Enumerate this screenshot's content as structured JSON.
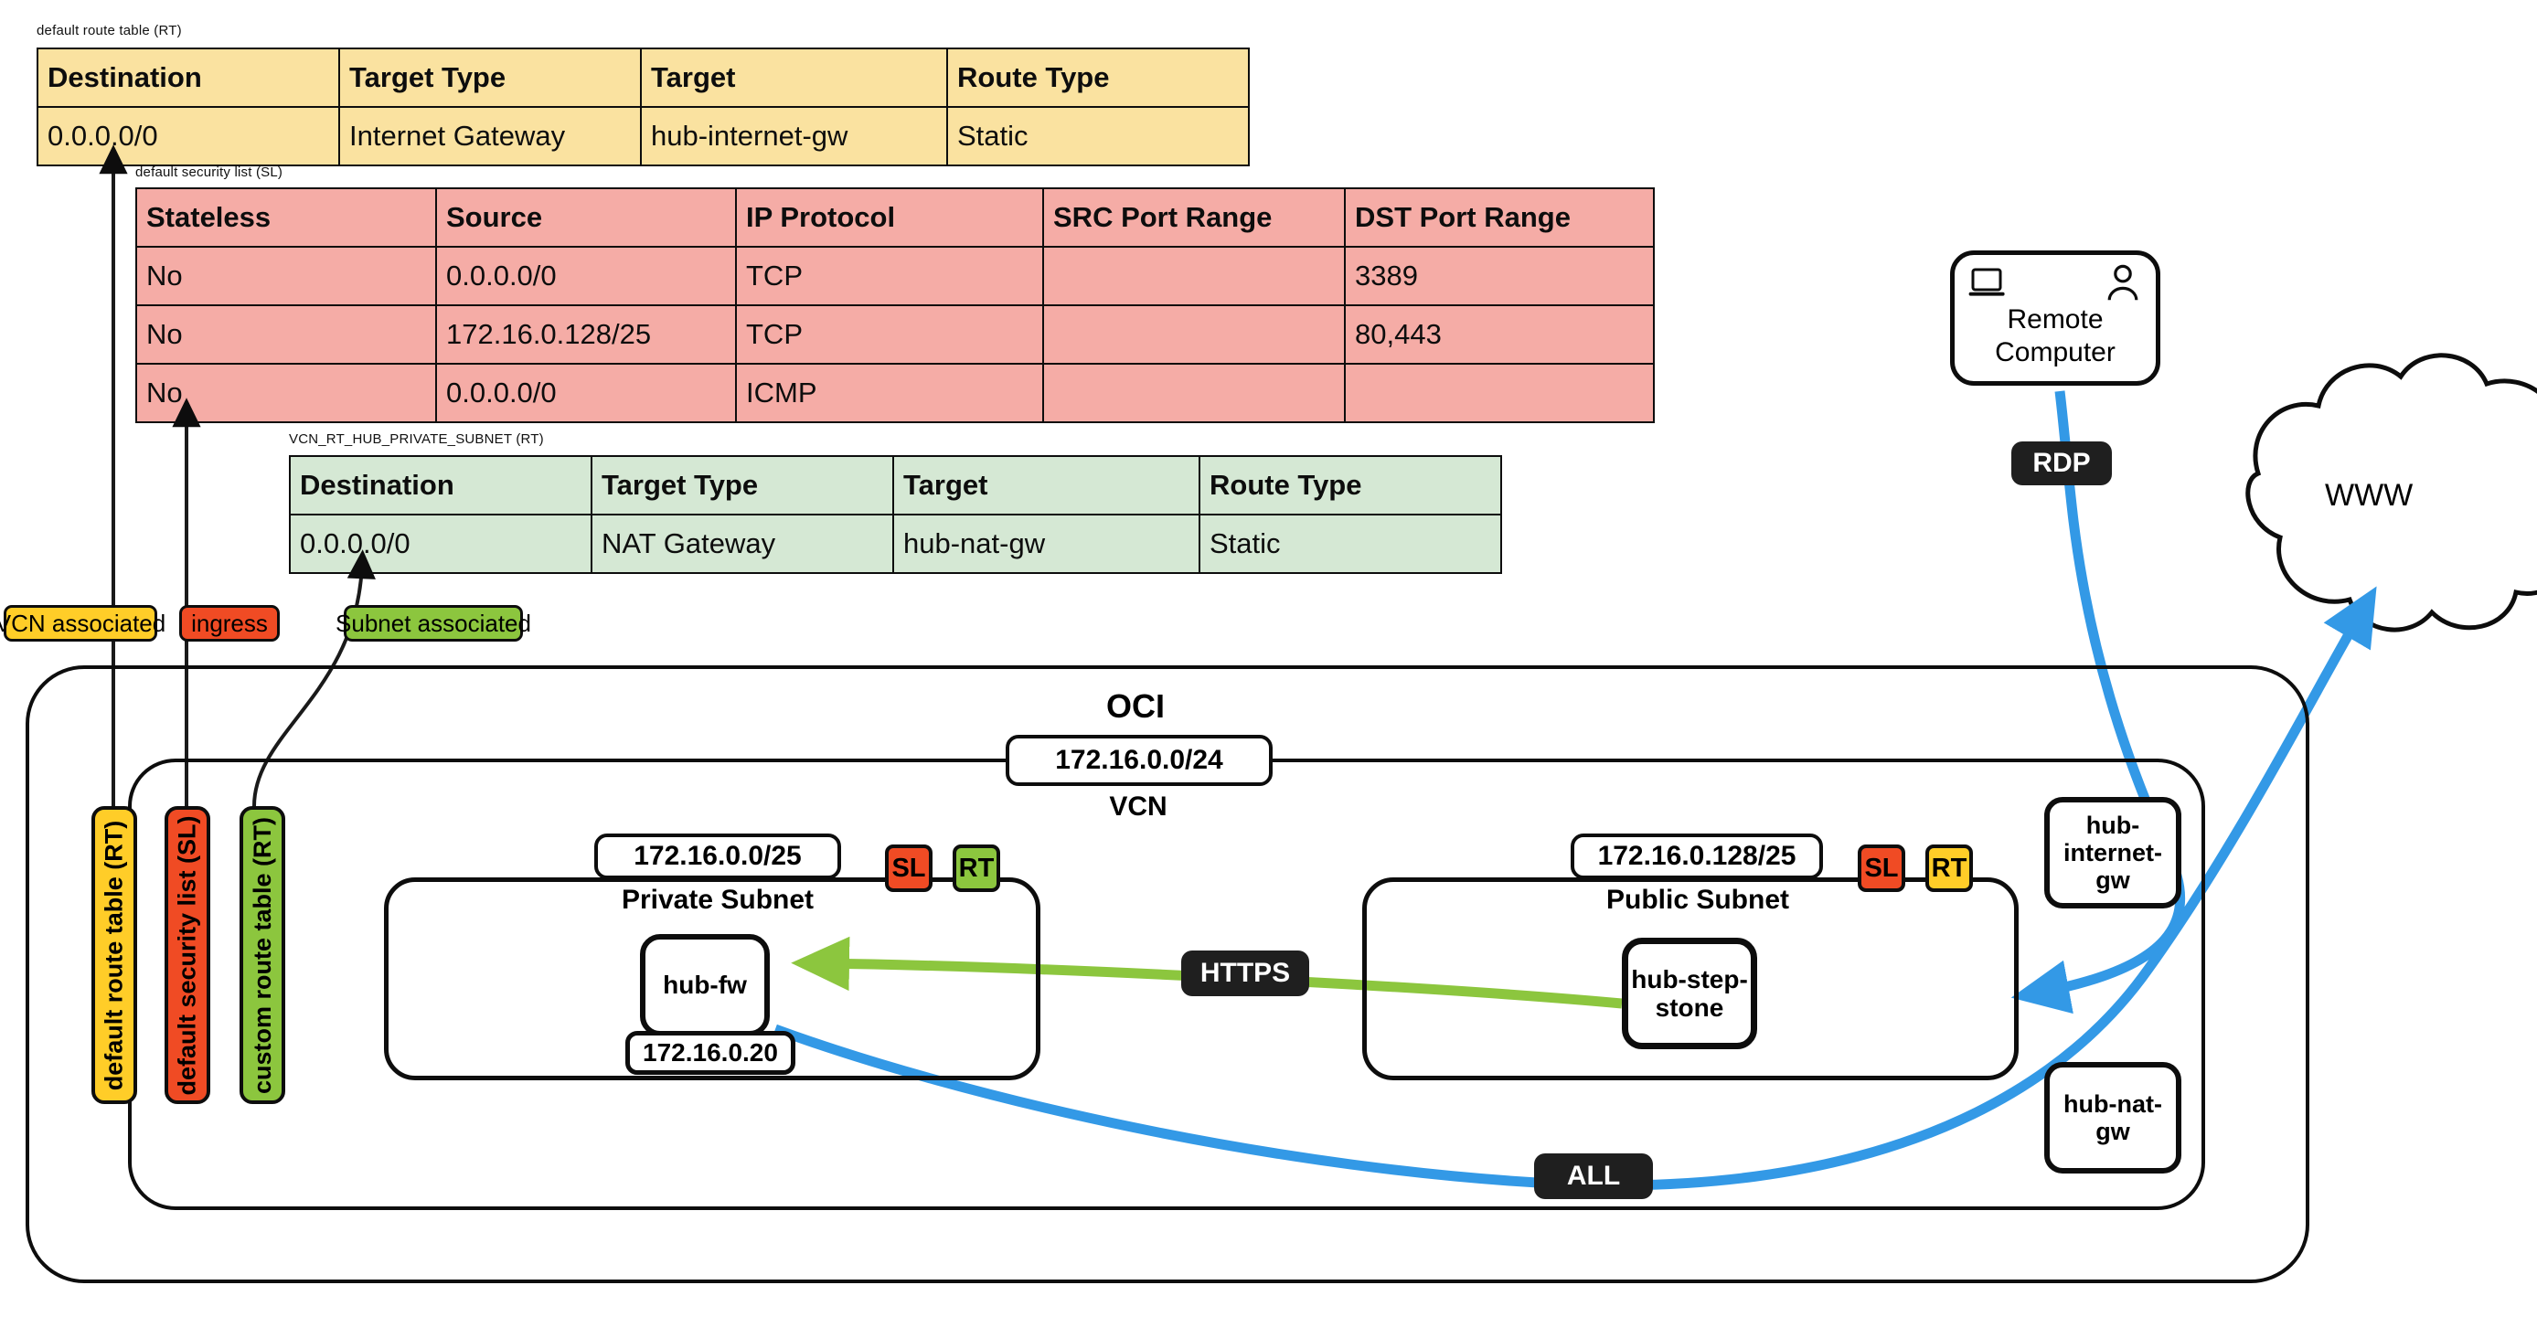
{
  "tables": [
    {
      "caption": "default route table (RT)",
      "theme": "yellow",
      "headers": [
        "Destination",
        "Target Type",
        "Target",
        "Route Type"
      ],
      "rows": [
        [
          "0.0.0.0/0",
          "Internet Gateway",
          "hub-internet-gw",
          "Static"
        ]
      ]
    },
    {
      "caption": "default security list (SL)",
      "theme": "red",
      "headers": [
        "Stateless",
        "Source",
        "IP Protocol",
        "SRC Port Range",
        "DST Port Range"
      ],
      "rows": [
        [
          "No",
          "0.0.0.0/0",
          "TCP",
          "",
          "3389"
        ],
        [
          "No",
          "172.16.0.128/25",
          "TCP",
          "",
          "80,443"
        ],
        [
          "No",
          "0.0.0.0/0",
          "ICMP",
          "",
          ""
        ]
      ]
    },
    {
      "caption": "VCN_RT_HUB_PRIVATE_SUBNET (RT)",
      "theme": "green",
      "headers": [
        "Destination",
        "Target Type",
        "Target",
        "Route Type"
      ],
      "rows": [
        [
          "0.0.0.0/0",
          "NAT Gateway",
          "hub-nat-gw",
          "Static"
        ]
      ]
    }
  ],
  "association_chips": [
    {
      "label": "VCN associated",
      "theme": "yellow"
    },
    {
      "label": "ingress",
      "theme": "red"
    },
    {
      "label": "Subnet associated",
      "theme": "green"
    }
  ],
  "vertical_chips": [
    {
      "label": "default route table (RT)",
      "theme": "yellow"
    },
    {
      "label": "default security list (SL)",
      "theme": "red"
    },
    {
      "label": "custom route table (RT)",
      "theme": "green"
    }
  ],
  "cloud_container": {
    "title": "OCI",
    "vcn_cidr": "172.16.0.0/24",
    "vcn_label": "VCN"
  },
  "subnets": [
    {
      "cidr": "172.16.0.0/25",
      "name": "Private Subnet",
      "badges": [
        {
          "label": "SL",
          "theme": "red"
        },
        {
          "label": "RT",
          "theme": "green"
        }
      ]
    },
    {
      "cidr": "172.16.0.128/25",
      "name": "Public Subnet",
      "badges": [
        {
          "label": "SL",
          "theme": "red"
        },
        {
          "label": "RT",
          "theme": "yellow"
        }
      ]
    }
  ],
  "nodes": {
    "firewall": {
      "label": "hub-fw",
      "ip": "172.16.0.20"
    },
    "stepstone": {
      "label": "hub-step-stone"
    },
    "internet_gateway": {
      "label": "hub-internet-gw"
    },
    "nat_gateway": {
      "label": "hub-nat-gw"
    },
    "remote_computer": {
      "label": "Remote Computer",
      "icons": [
        "laptop-icon",
        "person-icon"
      ]
    },
    "internet_cloud": {
      "label": "WWW"
    }
  },
  "edge_labels": [
    {
      "label": "RDP",
      "color": "#3399e6"
    },
    {
      "label": "HTTPS",
      "color": "#8cc63e"
    },
    {
      "label": "ALL",
      "color": "#3399e6"
    }
  ],
  "colors": {
    "yellow": "#ffcd28",
    "red": "#f04b24",
    "green": "#8cc63e",
    "blue_flow": "#3399e6",
    "green_flow": "#8cc63e",
    "table_yellow": "#fae2a0",
    "table_red": "#f5aca6",
    "table_green": "#d5e8d4",
    "stroke": "#0d0d0d"
  }
}
